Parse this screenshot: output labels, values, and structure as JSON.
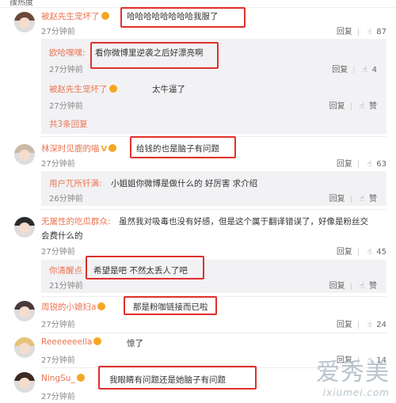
{
  "page_header": "搜热度",
  "comments": [
    {
      "user": "被赵先生宠坏了",
      "text": "哈哈哈哈哈哈哈哈我服了",
      "time": "27分钟前",
      "reply_label": "回复",
      "likes": "87",
      "replies": [
        {
          "user": "欧哈嘿嘿:",
          "text": "看你微博里逆袭之后好漂亮啊",
          "time": "27分钟前",
          "reply_label": "回复",
          "likes": "4"
        },
        {
          "user": "被赵先生宠坏了",
          "text": "太牛逼了",
          "time": "27分钟前",
          "reply_label": "回复",
          "likes": "赞"
        }
      ],
      "more_replies": "共3条回复"
    },
    {
      "user": "林深时见鹿的喵",
      "text": "给钱的也是脑子有问题",
      "time": "27分钟前",
      "reply_label": "回复",
      "likes": "63",
      "replies": [
        {
          "user": "用户兀所钎满:",
          "text": "小姐姐你微博是做什么的 好厉害 求介绍",
          "time": "26分钟前",
          "reply_label": "回复",
          "likes": "赞"
        }
      ]
    },
    {
      "user": "无屠性的吃瓜群众:",
      "text": "虽然我对吸毒也没有好感，但是这个属于翻译错误了，好像是粉丝交",
      "text2": "会费什么的",
      "time": "27分钟前",
      "reply_label": "回复",
      "likes": "45",
      "replies": [
        {
          "user": "你清醒点",
          "text": "希望是吧 不然太丢人了吧",
          "time": "21分钟前",
          "reply_label": "回复",
          "likes": "赞"
        }
      ]
    },
    {
      "user": "周锐的小媳妇a",
      "text": "那是粉咖链接而已啦",
      "time": "27分钟前",
      "reply_label": "回复",
      "likes": "24"
    },
    {
      "user": "Reeeeeeella",
      "text": "惊了",
      "time": "27分钟前",
      "reply_label": "回复",
      "likes": "14"
    },
    {
      "user": "NingSu_",
      "text": "我眼睛有问题还是她脑子有问题",
      "time": "27分钟前",
      "reply_label": "回复",
      "likes": ""
    }
  ],
  "watermark": {
    "brand": "爱秀美",
    "url": "ixiumei.com"
  },
  "colors": {
    "username": "#eb7350",
    "highlight_box": "#e0302a",
    "reply_bg": "#f2f2f5"
  },
  "icons": {
    "like": "thumbs-up-icon",
    "badge": "vip-badge-icon"
  }
}
